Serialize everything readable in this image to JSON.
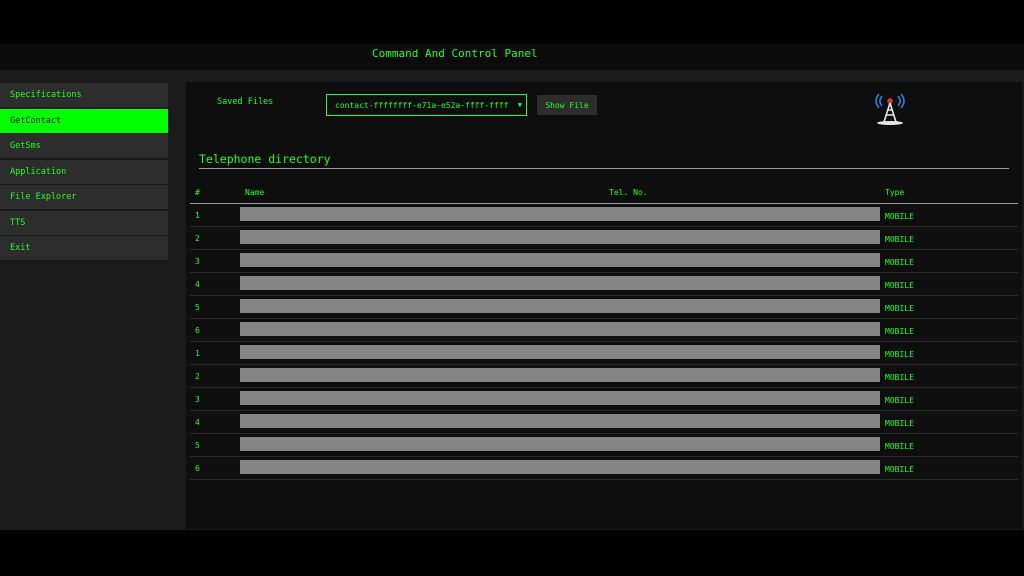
{
  "app": {
    "title": "Command And Control Panel"
  },
  "sidebar": {
    "items": [
      {
        "label": "Specifications",
        "active": false
      },
      {
        "label": "GetContact",
        "active": true
      },
      {
        "label": "GetSms",
        "active": false
      },
      {
        "label": "Application",
        "active": false
      },
      {
        "label": "File Explorer",
        "active": false
      },
      {
        "label": "TTS",
        "active": false
      },
      {
        "label": "Exit",
        "active": false
      }
    ]
  },
  "files": {
    "saved_label": "Saved Files",
    "selected": "contact-ffffffff-e71a-e52a-ffff-ffff",
    "show_button": "Show File",
    "status_icon": "signal-tower-icon"
  },
  "directory": {
    "title": "Telephone directory",
    "columns": {
      "num": "#",
      "name": "Name",
      "tel": "Tel. No.",
      "type": "Type"
    },
    "rows": [
      {
        "num": "1",
        "type": "MOBILE"
      },
      {
        "num": "2",
        "type": "MOBILE"
      },
      {
        "num": "3",
        "type": "MOBILE"
      },
      {
        "num": "4",
        "type": "MOBILE"
      },
      {
        "num": "5",
        "type": "MOBILE"
      },
      {
        "num": "6",
        "type": "MOBILE"
      },
      {
        "num": "1",
        "type": "MOBILE"
      },
      {
        "num": "2",
        "type": "MOBILE"
      },
      {
        "num": "3",
        "type": "MOBILE"
      },
      {
        "num": "4",
        "type": "MOBILE"
      },
      {
        "num": "5",
        "type": "MOBILE"
      },
      {
        "num": "6",
        "type": "MOBILE"
      }
    ]
  },
  "colors": {
    "accent": "#22ff22",
    "active_item": "#00ff00",
    "redacted": "#858585",
    "panel": "#0e0e0e",
    "sidebar_item": "#2d2d2d"
  }
}
